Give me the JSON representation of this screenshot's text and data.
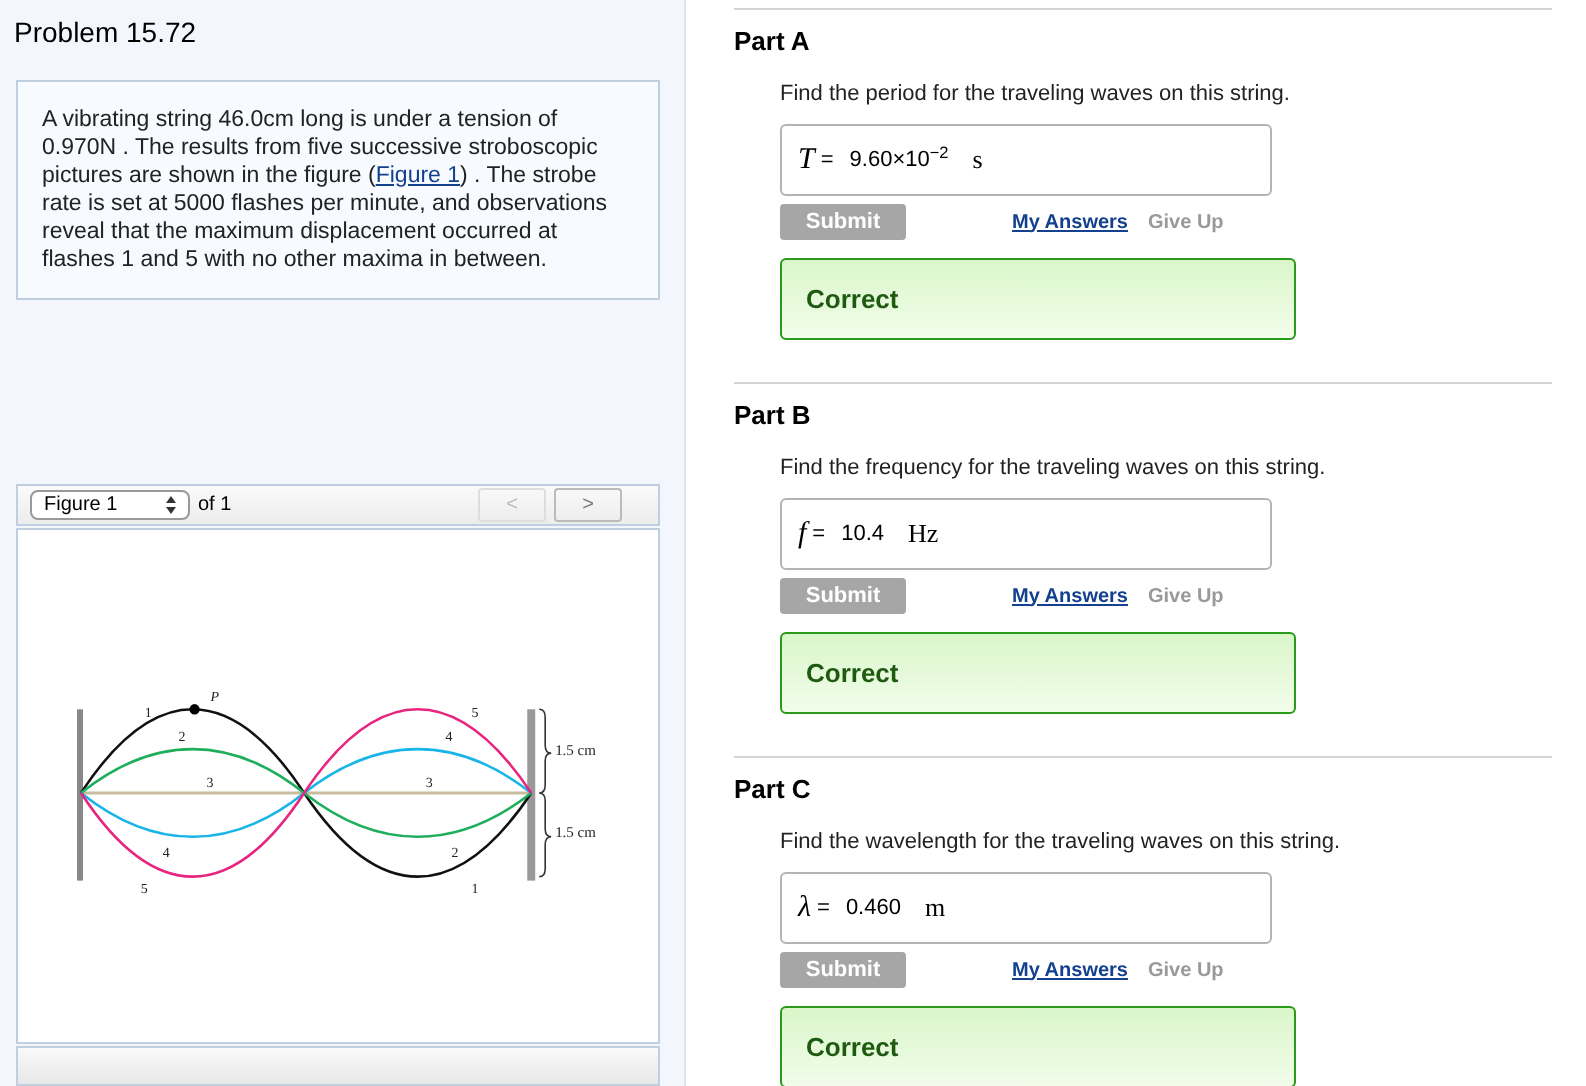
{
  "problem": {
    "title": "Problem 15.72",
    "text": "A vibrating string 46.0cm long is under a tension of 0.970N . The results from five successive stroboscopic pictures are shown in the figure (",
    "link": "Figure 1",
    "text_after": ") . The strobe rate is set at 5000 flashes per minute, and observations reveal that the maximum displacement occurred at flashes 1 and 5 with no other maxima in between."
  },
  "figure": {
    "selector": "Figure 1",
    "of": "of 1",
    "prev": "<",
    "next": ">",
    "prev_disabled": true,
    "next_disabled": false,
    "labels": [
      {
        "text": "1"
      },
      {
        "text": "P"
      },
      {
        "text": "2"
      },
      {
        "text": "3"
      },
      {
        "text": "4"
      },
      {
        "text": "5"
      },
      {
        "text": "5"
      },
      {
        "text": "4"
      },
      {
        "text": "3"
      },
      {
        "text": "2"
      },
      {
        "text": "1"
      },
      {
        "text": "1.5 cm"
      },
      {
        "text": "1.5 cm"
      }
    ]
  },
  "parts": [
    {
      "title": "Part A",
      "prompt": "Find the period for the traveling waves on this string.",
      "variable": "T",
      "equals": "=",
      "value": "9.60×10$^{−2}$",
      "unit": "s",
      "submit": "Submit",
      "submit_disabled": true,
      "my_answers": "My Answers",
      "give_up": "Give Up",
      "result": "Correct"
    },
    {
      "title": "Part B",
      "prompt": "Find the frequency for the traveling waves on this string.",
      "variable": "f",
      "equals": "=",
      "value": "10.4",
      "unit": "Hz",
      "submit": "Submit",
      "submit_disabled": true,
      "my_answers": "My Answers",
      "give_up": "Give Up",
      "result": "Correct"
    },
    {
      "title": "Part C",
      "prompt": "Find the wavelength for the traveling waves on this string.",
      "variable": "λ",
      "equals": "=",
      "value": "0.460",
      "unit": "m",
      "submit": "Submit",
      "submit_disabled": true,
      "my_answers": "My Answers",
      "give_up": "Give Up",
      "result": "Correct"
    }
  ]
}
